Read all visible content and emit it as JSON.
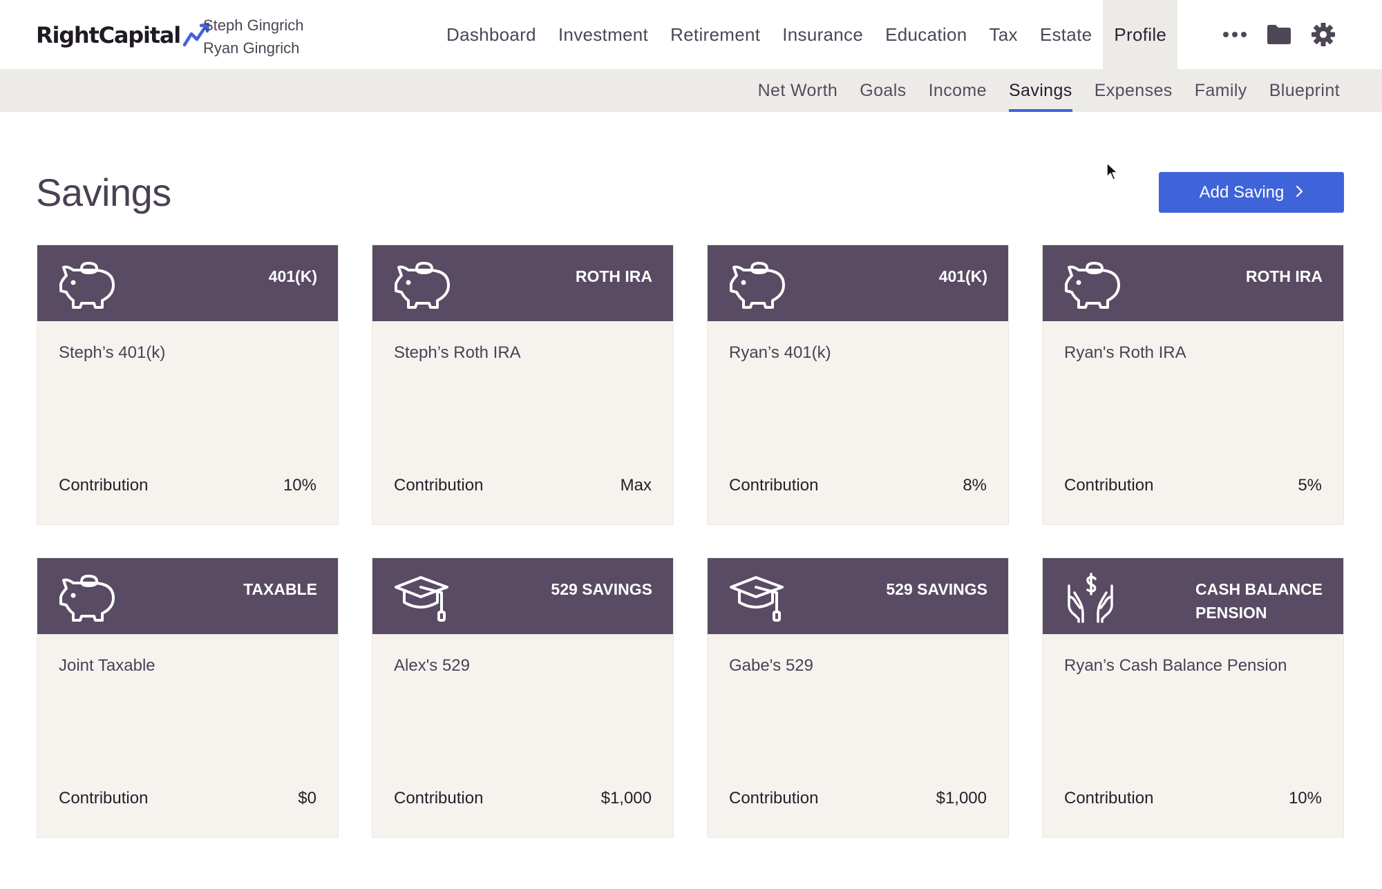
{
  "header": {
    "logo_text": "RightCapital",
    "clients": [
      "Steph Gingrich",
      "Ryan Gingrich"
    ]
  },
  "main_nav": [
    {
      "label": "Dashboard",
      "active": false
    },
    {
      "label": "Investment",
      "active": false
    },
    {
      "label": "Retirement",
      "active": false
    },
    {
      "label": "Insurance",
      "active": false
    },
    {
      "label": "Education",
      "active": false
    },
    {
      "label": "Tax",
      "active": false
    },
    {
      "label": "Estate",
      "active": false
    },
    {
      "label": "Profile",
      "active": true
    }
  ],
  "nav_icons": [
    "more-icon",
    "folder-icon",
    "gear-icon"
  ],
  "sub_nav": [
    {
      "label": "Net Worth",
      "active": false
    },
    {
      "label": "Goals",
      "active": false
    },
    {
      "label": "Income",
      "active": false
    },
    {
      "label": "Savings",
      "active": true
    },
    {
      "label": "Expenses",
      "active": false
    },
    {
      "label": "Family",
      "active": false
    },
    {
      "label": "Blueprint",
      "active": false
    }
  ],
  "page": {
    "title": "Savings",
    "add_button_label": "Add Saving",
    "add_button_icon": "chevron-right-icon"
  },
  "colors": {
    "accent": "#3f63d9",
    "card_header": "#594b63",
    "card_body": "#f6f3ef",
    "subnav_bg": "#ecebe8"
  },
  "cards": [
    {
      "type": "401(K)",
      "icon": "piggy-bank-icon",
      "name": "Steph’s 401(k)",
      "contribution_label": "Contribution",
      "contribution": "10%"
    },
    {
      "type": "ROTH IRA",
      "icon": "piggy-bank-icon",
      "name": "Steph’s Roth IRA",
      "contribution_label": "Contribution",
      "contribution": "Max"
    },
    {
      "type": "401(K)",
      "icon": "piggy-bank-icon",
      "name": "Ryan’s 401(k)",
      "contribution_label": "Contribution",
      "contribution": "8%"
    },
    {
      "type": "ROTH IRA",
      "icon": "piggy-bank-icon",
      "name": "Ryan's Roth IRA",
      "contribution_label": "Contribution",
      "contribution": "5%"
    },
    {
      "type": "TAXABLE",
      "icon": "piggy-bank-icon",
      "name": "Joint Taxable",
      "contribution_label": "Contribution",
      "contribution": "$0"
    },
    {
      "type": "529 SAVINGS",
      "icon": "graduation-cap-icon",
      "name": "Alex's 529",
      "contribution_label": "Contribution",
      "contribution": "$1,000"
    },
    {
      "type": "529 SAVINGS",
      "icon": "graduation-cap-icon",
      "name": "Gabe's 529",
      "contribution_label": "Contribution",
      "contribution": "$1,000"
    },
    {
      "type": "CASH BALANCE PENSION",
      "type_lines": [
        "CASH BALANCE",
        "PENSION"
      ],
      "icon": "hands-dollar-icon",
      "name": "Ryan’s Cash Balance Pension",
      "contribution_label": "Contribution",
      "contribution": "10%"
    }
  ]
}
